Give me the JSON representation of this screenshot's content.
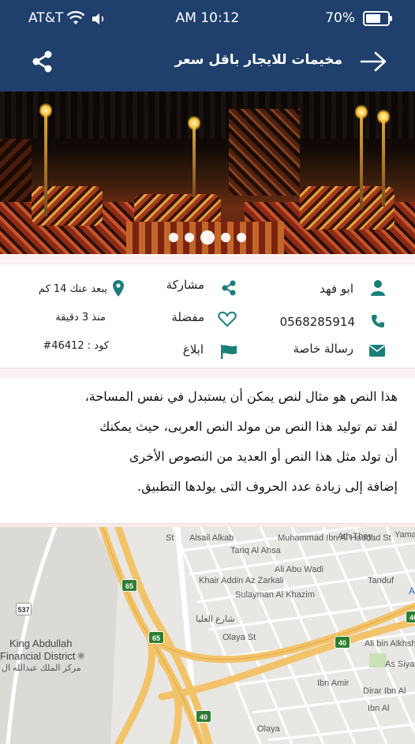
{
  "status": {
    "carrier": "AT&T",
    "time": "AM 10:12",
    "battery": "70%",
    "battery_level": 0.7
  },
  "header": {
    "title": "مخيمات للايجار باقل سعر",
    "back_icon": "arrow-right-icon",
    "share_icon": "share-icon"
  },
  "gallery": {
    "dots": 5,
    "active_index": 2
  },
  "info": {
    "owner": "ابو فهد",
    "phone": "0568285914",
    "message": "رسالة خاصة",
    "share": "مشاركة",
    "favorite": "مفضلة",
    "report": "ابلاغ",
    "distance": "يبعد عنك 14 كم",
    "posted": "منذ 3 دقيقة",
    "code": "كود : 46412#",
    "accent": "#1a7f7a"
  },
  "description": [
    "هذا النص هو مثال لنص يمكن أن يستبدل في نفس المساحة،",
    "لقد تم توليد هذا النص من مولد النص العربى، حيث يمكنك",
    "أن تولد مثل هذا النص أو العديد من النصوص الأخرى",
    "إضافة إلى زيادة عدد الحروف التى يولدها التطبيق."
  ],
  "map": {
    "labels": {
      "district_en_1": "King Abdullah",
      "district_en_2": "Financial District",
      "district_ar": "مركز الملك عبدالله ال",
      "tariq": "Tariq Al Ahsa",
      "asail": "Alsail Alkab",
      "khair": "Khair Addin Az Zarkali",
      "sulayman": "Sulayman Al Khazim",
      "abu_wadi": "Ali Abu Wadi",
      "muhammad": "Muhammad Ibn Al Haddad St",
      "athar": "Ath Thay",
      "yamani": "Yamani",
      "tanduf": "Tanduf",
      "alkhsh": "Ali bin Alkhsh",
      "asyad": "As Siyad",
      "dirar": "Dirar Ibn Al",
      "ibn_amir": "Ibn Amir",
      "olaya": "Olaya St",
      "olaya2": "Olaya",
      "olaya_ar": "شارع العليا",
      "ibn_al": "Ibn Al",
      "st_frag": "St",
      "a_frag": "A"
    },
    "shields": [
      "537",
      "65",
      "65",
      "40",
      "40",
      "40"
    ]
  }
}
